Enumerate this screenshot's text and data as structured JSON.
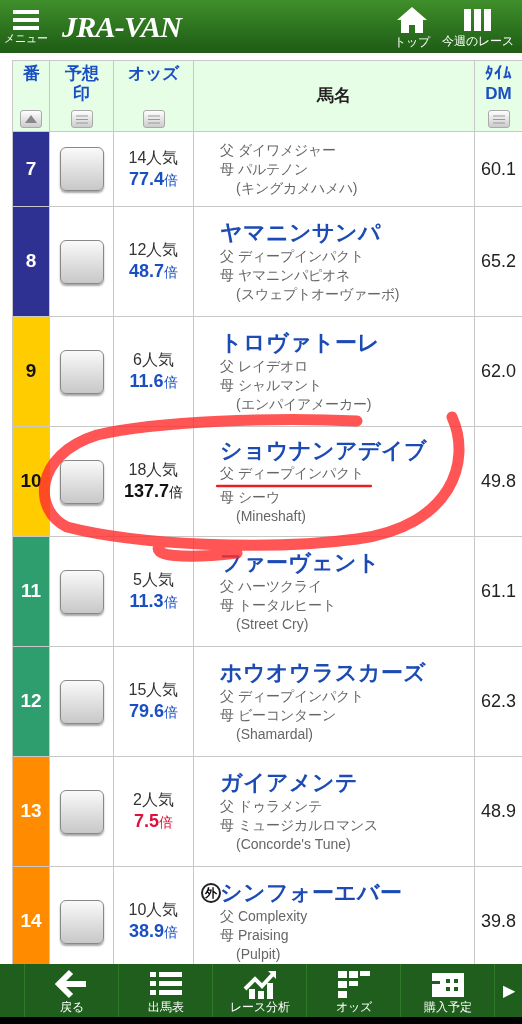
{
  "header": {
    "menu_label": "メニュー",
    "logo": "JRA-VAN",
    "actions": [
      {
        "kind": "home",
        "label": "トップ"
      },
      {
        "kind": "columns",
        "label": "今週のレース"
      }
    ]
  },
  "table": {
    "columns": [
      {
        "label": "番",
        "kind": "sort-up"
      },
      {
        "label": "予想印",
        "kind": "menu"
      },
      {
        "label": "オッズ",
        "kind": "menu"
      },
      {
        "label": "馬名",
        "kind": "plain"
      },
      {
        "label": "ﾀｲﾑ",
        "sublabel": "DM",
        "kind": "menu"
      }
    ],
    "rows": [
      {
        "number": "7",
        "color": "#2e3192",
        "popularity": "14人気",
        "odds": {
          "value": "77.4",
          "unit": "倍",
          "color": "#1a4fc4"
        },
        "sire": "父 ダイワメジャー",
        "dam": "母 パルテノン",
        "damsire": "(キングカメハメハ)",
        "time_dm": "60.1",
        "checked": false,
        "circled": false,
        "clipped": true
      },
      {
        "number": "8",
        "color": "#2e3192",
        "popularity": "12人気",
        "odds": {
          "value": "48.7",
          "unit": "倍",
          "color": "#1a4fc4"
        },
        "name": "ヤマニンサンパ",
        "sire": "父 ディープインパクト",
        "dam": "母 ヤマニンパピオネ",
        "damsire": "(スウェプトオーヴァーボ)",
        "time_dm": "65.2",
        "checked": false,
        "circled": false,
        "clipped": false
      },
      {
        "number": "9",
        "color": "#ffcc00",
        "popularity": "6人気",
        "odds": {
          "value": "11.6",
          "unit": "倍",
          "color": "#1a4fc4"
        },
        "name": "トロヴァトーレ",
        "sire": "父 レイデオロ",
        "dam": "母 シャルマント",
        "damsire": "(エンパイアメーカー)",
        "time_dm": "62.0",
        "checked": false,
        "circled": false,
        "clipped": false
      },
      {
        "number": "10",
        "color": "#ffcc00",
        "popularity": "18人気",
        "odds": {
          "value": "137.7",
          "unit": "倍",
          "color": "#111111"
        },
        "name": "ショウナンアデイブ",
        "sire": "父 ディープインパクト",
        "dam": "母 シーウ",
        "damsire": "(Mineshaft)",
        "time_dm": "49.8",
        "checked": false,
        "circled": true,
        "clipped": false
      },
      {
        "number": "11",
        "color": "#2e9e6e",
        "popularity": "5人気",
        "odds": {
          "value": "11.3",
          "unit": "倍",
          "color": "#1a4fc4"
        },
        "name": "ファーヴェント",
        "sire": "父 ハーツクライ",
        "dam": "母 トータルヒート",
        "damsire": "(Street Cry)",
        "time_dm": "61.1",
        "checked": false,
        "circled": false,
        "clipped": false
      },
      {
        "number": "12",
        "color": "#2e9e6e",
        "popularity": "15人気",
        "odds": {
          "value": "79.6",
          "unit": "倍",
          "color": "#1a4fc4"
        },
        "name": "ホウオウラスカーズ",
        "sire": "父 ディープインパクト",
        "dam": "母 ビーコンターン",
        "damsire": "(Shamardal)",
        "time_dm": "62.3",
        "checked": false,
        "circled": false,
        "clipped": false
      },
      {
        "number": "13",
        "color": "#ff8c00",
        "popularity": "2人気",
        "odds": {
          "value": "7.5",
          "unit": "倍",
          "color": "#e0103a"
        },
        "name": "ガイアメンテ",
        "sire": "父 ドゥラメンテ",
        "dam": "母 ミュージカルロマンス",
        "damsire": "(Concorde's Tune)",
        "time_dm": "48.9",
        "checked": false,
        "circled": false,
        "clipped": false
      },
      {
        "number": "14",
        "color": "#ff8c00",
        "popularity": "10人気",
        "odds": {
          "value": "38.9",
          "unit": "倍",
          "color": "#1a4fc4"
        },
        "badge": "外",
        "name": "シンフォーエバー",
        "sire": "父 Complexity",
        "dam": "母 Praising",
        "damsire": "(Pulpit)",
        "time_dm": "39.8",
        "checked": false,
        "circled": false,
        "clipped": false
      }
    ]
  },
  "bottom_nav": {
    "items": [
      {
        "kind": "back",
        "label": "戻る"
      },
      {
        "kind": "list",
        "label": "出馬表"
      },
      {
        "kind": "chart",
        "label": "レース分析"
      },
      {
        "kind": "odds",
        "label": "オッズ"
      },
      {
        "kind": "plan",
        "label": "購入予定"
      }
    ],
    "more": "▶"
  }
}
